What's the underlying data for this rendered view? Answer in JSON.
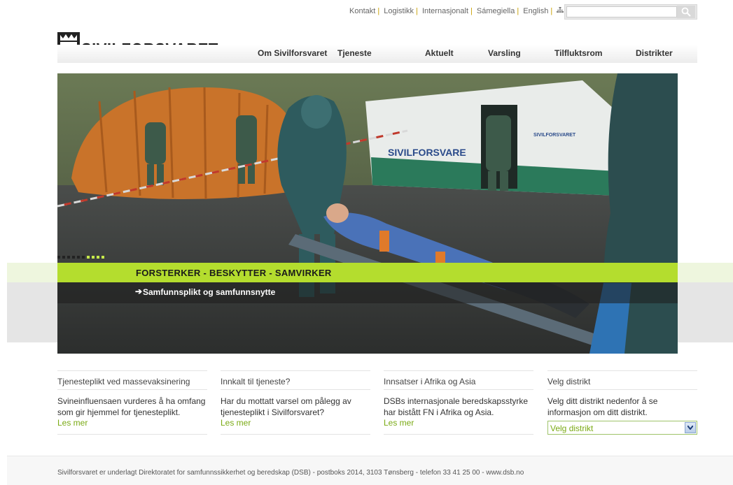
{
  "top_links": [
    "Kontakt",
    "Logistikk",
    "Internasjonalt",
    "Sámegiella",
    "English"
  ],
  "search": {
    "placeholder": ""
  },
  "logo": {
    "text": "SIVILFORSVARET"
  },
  "nav": [
    "Om Sivilforsvaret",
    "Tjeneste",
    "Aktuelt",
    "Varsling",
    "Tilfluktsrom",
    "Distrikter"
  ],
  "hero": {
    "slogan": "FORSTERKER - BESKYTTER - SAMVIRKER",
    "caption": "Samfunnsplikt og samfunnsnytte",
    "tent_label": "SIVILFORSVARE",
    "tent_label_small": "SIVILFORSVARET",
    "slide_count": 10,
    "active_slide_start": 6
  },
  "columns": [
    {
      "title": "Tjenesteplikt ved massevaksinering",
      "text": "Svineinfluensaen vurderes å ha omfang som gir hjemmel for tjenesteplikt.",
      "more": "Les mer"
    },
    {
      "title": "Innkalt til tjeneste?",
      "text": "Har du mottatt varsel om pålegg av tjenesteplikt i Sivilforsvaret?",
      "more": "Les mer"
    },
    {
      "title": "Innsatser i Afrika og Asia",
      "text": "DSBs internasjonale beredskapsstyrke har bistått FN i Afrika og Asia.",
      "more": "Les mer"
    },
    {
      "title": "Velg distrikt",
      "text": "Velg ditt distrikt nedenfor å se informasjon om ditt distrikt.",
      "select_value": "Velg distrikt"
    }
  ],
  "footer": "Sivilforsvaret er underlagt Direktoratet for samfunnssikkerhet og beredskap (DSB) - postboks 2014, 3103 Tønsberg - telefon 33 41 25 00 - www.dsb.no",
  "colors": {
    "accent_green": "#b4dd2e",
    "link_green": "#7aaa14"
  },
  "icons": [
    "sitemap-icon",
    "search-icon",
    "crest-icon",
    "arrow-right-icon",
    "chevron-down-icon"
  ]
}
